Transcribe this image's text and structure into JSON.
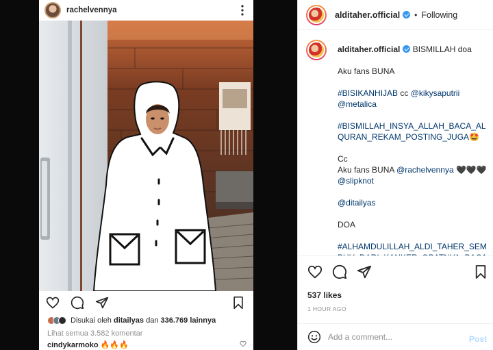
{
  "left_post": {
    "username": "rachelvennya",
    "liked_by_prefix": "Disukai oleh",
    "liked_by_user": "ditailyas",
    "liked_by_mid": "dan",
    "liked_by_count": "336.769 lainnya",
    "view_comments": "Lihat semua 3.582 komentar",
    "first_comment_user": "cindykarmoko",
    "first_comment_text": "🔥🔥🔥"
  },
  "post": {
    "username": "alditaher.official",
    "separator": "•",
    "follow_status": "Following",
    "caption": {
      "lead": "BISMILLAH doa",
      "line_fans": "Aku fans BUNA",
      "tag_hijab": "#BISIKANHIJAB",
      "cc_word": "cc",
      "mention_kiky": "@kikysaputrii",
      "mention_metalica": "@metalica",
      "tag_quran": "#BISMILLAH_INSYA_ALLAH_BACA_ALQURAN_REKAM_POSTING_JUGA",
      "emoji_quran": "🤩",
      "cc2": "Cc",
      "fans_prefix": "Aku fans BUNA",
      "mention_rachel": "@rachelvennya",
      "hearts": "🖤🖤🖤",
      "mention_slipknot": "@slipknot",
      "mention_ditailyas": "@ditailyas",
      "doa": "DOA",
      "tag_alhamdulillah": "#ALHAMDULILLAH_ALDI_TAHER_SEMBUH_DARI_KANKER_OBATNYA_BACA"
    },
    "likes": "537 likes",
    "time": "1 HOUR AGO",
    "comment_placeholder": "Add a comment...",
    "post_button": "Post"
  },
  "colors": {
    "link": "#00376b",
    "muted": "#8e8e8e",
    "verified": "#3897f0",
    "post_button_disabled": "#b3dbff"
  }
}
